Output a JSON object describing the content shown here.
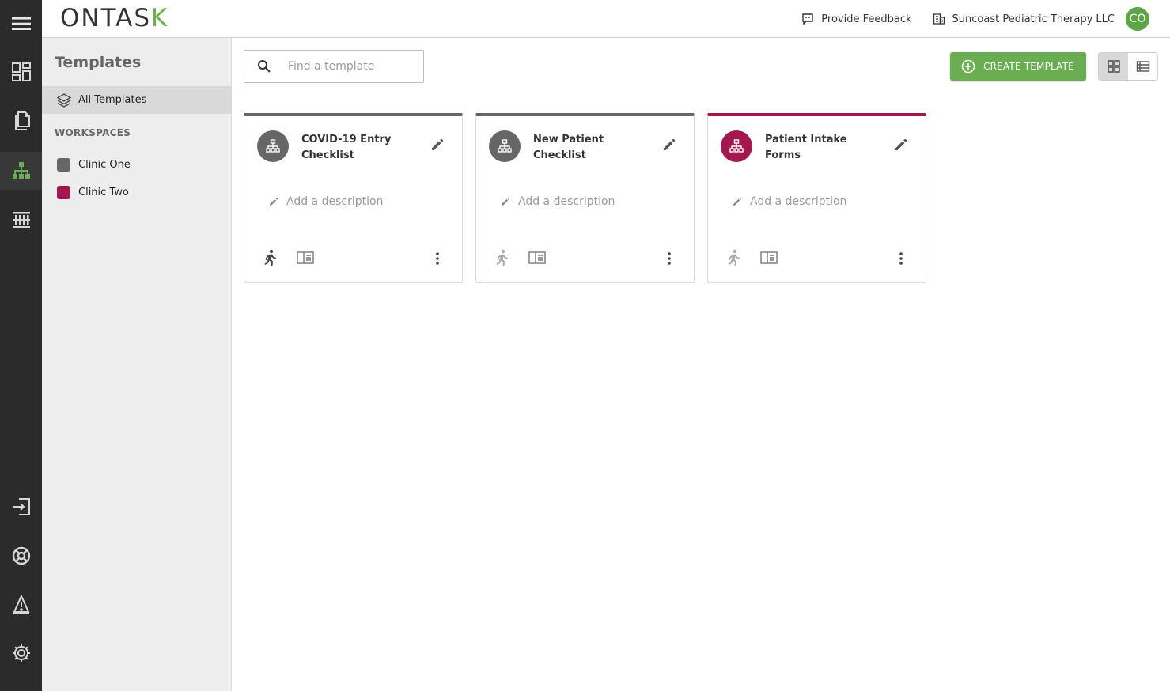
{
  "app": {
    "logo_text": "ONTAS",
    "logo_accent": "K",
    "brand_color": "#6aad52"
  },
  "topbar": {
    "feedback_label": "Provide Feedback",
    "org_name": "Suncoast Pediatric Therapy LLC",
    "avatar_initials": "CO"
  },
  "rail": {
    "items": [
      "menu-icon",
      "dashboard-icon",
      "documents-icon",
      "templates-icon",
      "processes-icon",
      "exit-icon",
      "help-icon",
      "alert-icon",
      "settings-icon"
    ],
    "active": "templates-icon"
  },
  "sidebar": {
    "title": "Templates",
    "all_label": "All Templates",
    "section_label": "WORKSPACES",
    "workspaces": [
      {
        "label": "Clinic One",
        "color": "#666666"
      },
      {
        "label": "Clinic Two",
        "color": "#a3194f"
      }
    ]
  },
  "search": {
    "placeholder": "Find a template",
    "value": ""
  },
  "toolbar": {
    "create_label": "CREATE TEMPLATE",
    "view_mode": "grid"
  },
  "cards": [
    {
      "title": "COVID-19 Entry Checklist",
      "description_placeholder": "Add a description",
      "color": "#666666"
    },
    {
      "title": "New Patient Checklist",
      "description_placeholder": "Add a description",
      "color": "#666666"
    },
    {
      "title": "Patient Intake Forms",
      "description_placeholder": "Add a description",
      "color": "#a3194f"
    }
  ]
}
